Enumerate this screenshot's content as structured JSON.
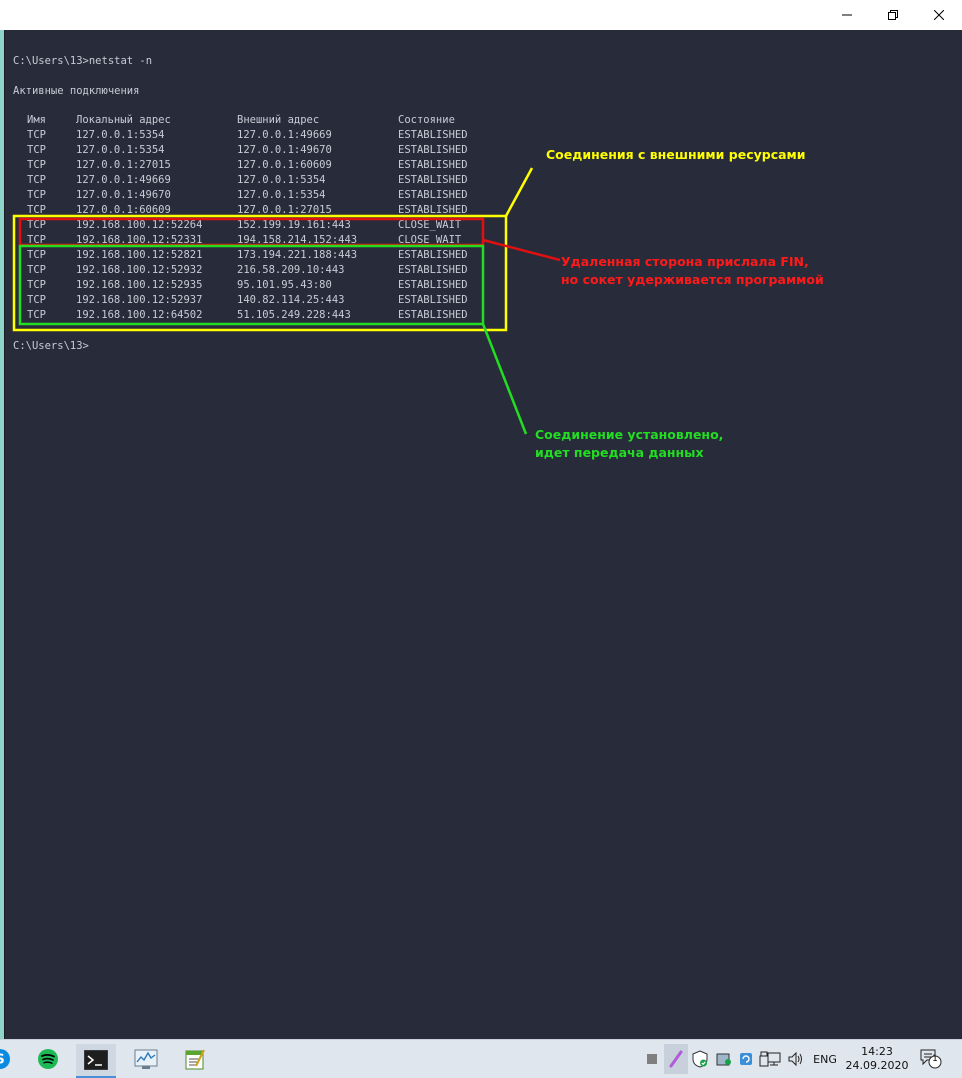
{
  "window": {
    "minimize_icon": "minimize-icon",
    "maximize_icon": "restore-icon",
    "close_icon": "close-icon"
  },
  "terminal": {
    "command_line": "C:\\Users\\13>netstat -n",
    "section_title": "Активные подключения",
    "headers": [
      "Имя",
      "Локальный адрес",
      "Внешний адрес",
      "Состояние"
    ],
    "rows": [
      [
        "TCP",
        "127.0.0.1:5354",
        "127.0.0.1:49669",
        "ESTABLISHED"
      ],
      [
        "TCP",
        "127.0.0.1:5354",
        "127.0.0.1:49670",
        "ESTABLISHED"
      ],
      [
        "TCP",
        "127.0.0.1:27015",
        "127.0.0.1:60609",
        "ESTABLISHED"
      ],
      [
        "TCP",
        "127.0.0.1:49669",
        "127.0.0.1:5354",
        "ESTABLISHED"
      ],
      [
        "TCP",
        "127.0.0.1:49670",
        "127.0.0.1:5354",
        "ESTABLISHED"
      ],
      [
        "TCP",
        "127.0.0.1:60609",
        "127.0.0.1:27015",
        "ESTABLISHED"
      ],
      [
        "TCP",
        "192.168.100.12:52264",
        "152.199.19.161:443",
        "CLOSE_WAIT"
      ],
      [
        "TCP",
        "192.168.100.12:52331",
        "194.158.214.152:443",
        "CLOSE_WAIT"
      ],
      [
        "TCP",
        "192.168.100.12:52821",
        "173.194.221.188:443",
        "ESTABLISHED"
      ],
      [
        "TCP",
        "192.168.100.12:52932",
        "216.58.209.10:443",
        "ESTABLISHED"
      ],
      [
        "TCP",
        "192.168.100.12:52935",
        "95.101.95.43:80",
        "ESTABLISHED"
      ],
      [
        "TCP",
        "192.168.100.12:52937",
        "140.82.114.25:443",
        "ESTABLISHED"
      ],
      [
        "TCP",
        "192.168.100.12:64502",
        "51.105.249.228:443",
        "ESTABLISHED"
      ]
    ],
    "prompt": "C:\\Users\\13>"
  },
  "annotations": {
    "external": {
      "text": "Соединения с внешними ресурсами",
      "color": "#ffff00"
    },
    "fin": {
      "line1": "Удаленная сторона прислала FIN,",
      "line2": "но сокет удерживается программой",
      "color": "#ff1a1a"
    },
    "established": {
      "line1": "Соединение установлено,",
      "line2": "идет передача данных",
      "color": "#22dd22"
    }
  },
  "taskbar": {
    "apps": [
      "skype-icon",
      "spotify-icon",
      "terminal-icon",
      "resource-monitor-icon",
      "notepad-icon"
    ],
    "language": "ENG",
    "time": "14:23",
    "date": "24.09.2020",
    "notification_count": "1"
  }
}
